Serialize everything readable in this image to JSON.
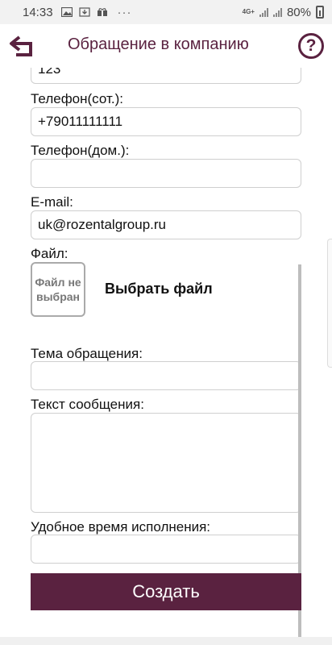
{
  "status": {
    "time": "14:33",
    "icons": [
      "image-icon",
      "download-icon",
      "gift-icon"
    ],
    "more": "···",
    "network": "4G+",
    "battery": "80%"
  },
  "header": {
    "back_icon": "back-arrow-icon",
    "title": "Обращение в компанию",
    "help": "?"
  },
  "form": {
    "prev_field_value": "123",
    "mobile_label": "Телефон(сот.):",
    "mobile_value": "+79011111111",
    "home_label": "Телефон(дом.):",
    "home_value": "",
    "email_label": "E-mail:",
    "email_value": "uk@rozentalgroup.ru",
    "file_label": "Файл:",
    "file_status": "Файл не выбран",
    "choose_file": "Выбрать файл",
    "subject_label": "Тема обращения:",
    "subject_value": "",
    "message_label": "Текст сообщения:",
    "message_value": "",
    "time_label": "Удобное время исполнения:",
    "time_value": "",
    "submit": "Создать"
  },
  "colors": {
    "accent": "#5a2240",
    "border": "#cfcfcf"
  }
}
